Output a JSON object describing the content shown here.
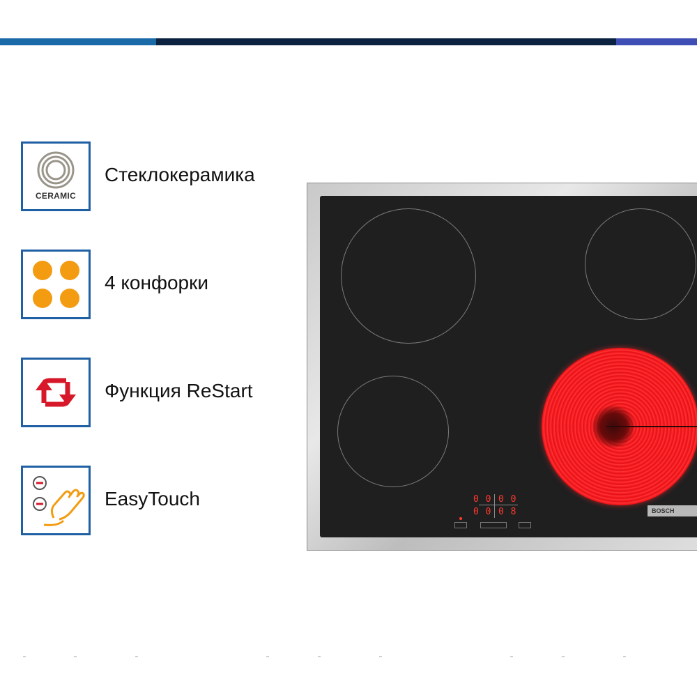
{
  "features": [
    {
      "label": "Стеклокерамика",
      "icon": "ceramic-rings-icon",
      "icon_text": "CERAMIC"
    },
    {
      "label": "4 конфорки",
      "icon": "four-burners-icon"
    },
    {
      "label": "Функция ReStart",
      "icon": "restart-arrows-icon"
    },
    {
      "label": "EasyTouch",
      "icon": "easytouch-hand-icon"
    }
  ],
  "colors": {
    "frame_blue": "#1f5fa3",
    "burner_orange": "#f39c12",
    "restart_red": "#d6182a",
    "topbar_left": "#1b6aa8",
    "topbar_dark": "#0b2240",
    "topbar_right": "#3f4eb5"
  },
  "product": {
    "brand": "BOSCH",
    "display_left": "0 0",
    "display_right": "0 0",
    "display_left_bottom": "0 0",
    "display_right_bottom": "0 8"
  }
}
